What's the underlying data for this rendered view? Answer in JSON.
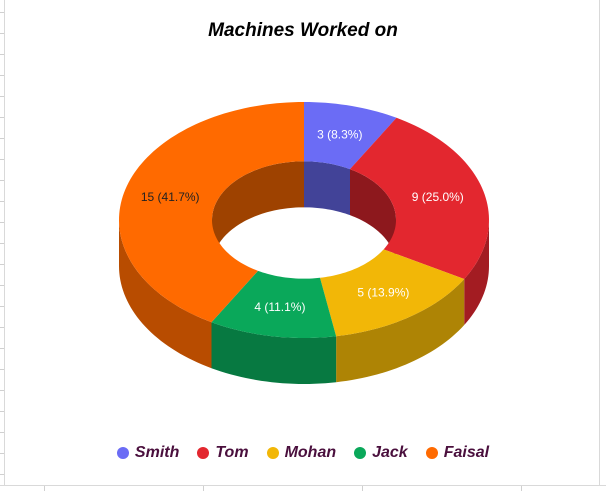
{
  "chart_data": {
    "type": "pie",
    "variant": "donut-3d",
    "title": "Machines Worked on",
    "slices": [
      {
        "name": "Smith",
        "value": 3,
        "label": "3 (8.3%)",
        "color": "#6b6cf5"
      },
      {
        "name": "Tom",
        "value": 9,
        "label": "9 (25.0%)",
        "color": "#e3272f"
      },
      {
        "name": "Mohan",
        "value": 5,
        "label": "5 (13.9%)",
        "color": "#f2b707"
      },
      {
        "name": "Jack",
        "value": 4,
        "label": "4 (11.1%)",
        "color": "#0aa85a"
      },
      {
        "name": "Faisal",
        "value": 15,
        "label": "15 (41.7%)",
        "color": "#ff6a00"
      }
    ],
    "legend_position": "bottom"
  }
}
